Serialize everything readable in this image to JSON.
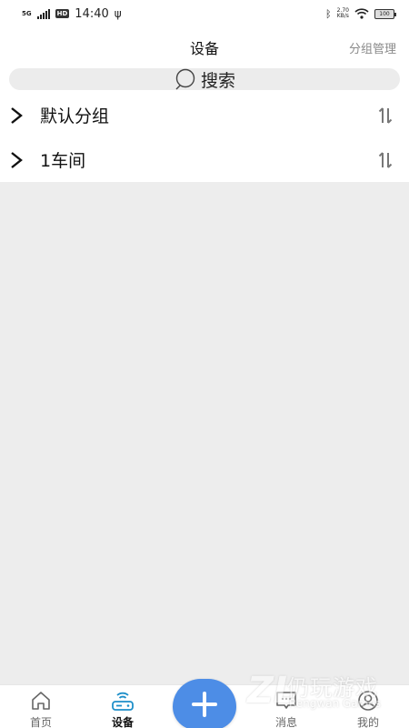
{
  "status_bar": {
    "network": "5G",
    "hd": "HD",
    "time": "14:40",
    "speed_value": "2.70",
    "speed_unit": "KB/s",
    "battery": "100"
  },
  "header": {
    "title": "设备",
    "action": "分组管理"
  },
  "search": {
    "label": "搜索"
  },
  "groups": [
    {
      "name": "默认分组"
    },
    {
      "name": "1车间"
    }
  ],
  "tab_bar": {
    "tabs": [
      {
        "label": "首页"
      },
      {
        "label": "设备"
      },
      {
        "label": "消息"
      },
      {
        "label": "我的"
      }
    ],
    "active": "设备"
  },
  "watermark": {
    "logo": "ZL",
    "cn": "仍玩游戏",
    "en": "Rengwan Games"
  },
  "colors": {
    "accent": "#4d8de6",
    "active_icon": "#1e8fc9",
    "background": "#ededed"
  }
}
